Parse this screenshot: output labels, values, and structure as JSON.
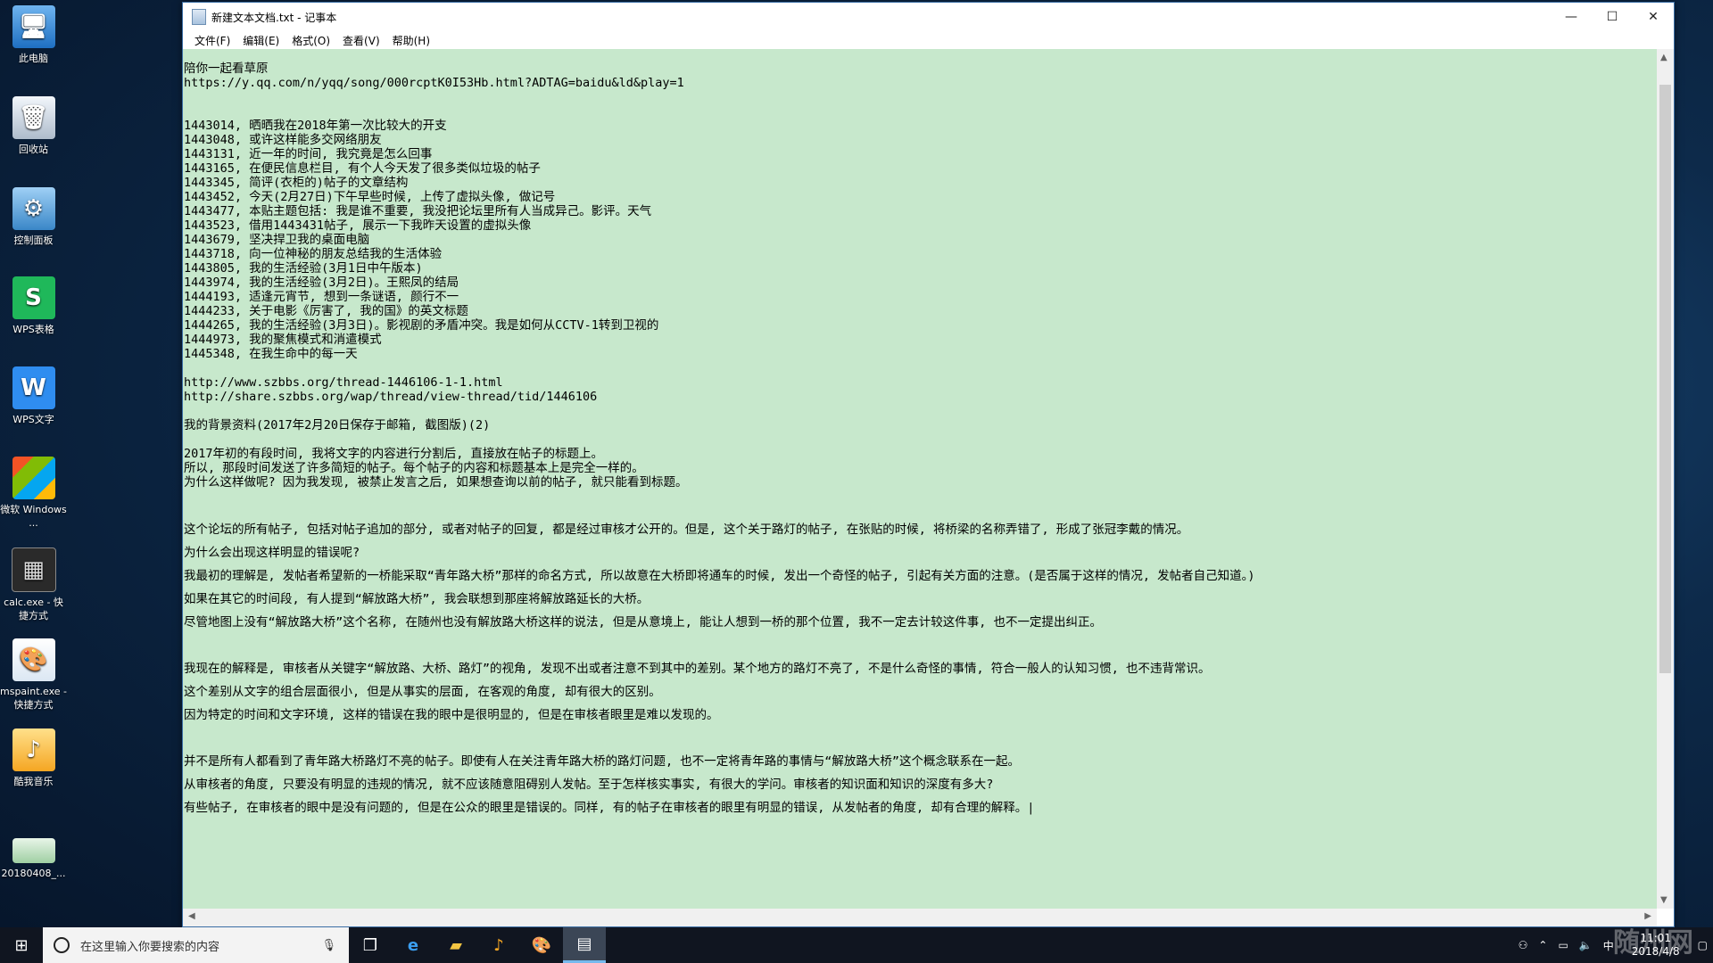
{
  "desktop_icons": [
    {
      "label": "此电脑",
      "icon": "computer-icon"
    },
    {
      "label": "回收站",
      "icon": "recycle-bin-icon"
    },
    {
      "label": "控制面板",
      "icon": "control-panel-icon"
    },
    {
      "label": "WPS表格",
      "icon": "wps-sheet-icon"
    },
    {
      "label": "WPS文字",
      "icon": "wps-writer-icon"
    },
    {
      "label": "微软 Windows ...",
      "icon": "windows-logo-icon"
    },
    {
      "label": "calc.exe - 快捷方式",
      "icon": "calculator-icon"
    },
    {
      "label": "mspaint.exe - 快捷方式",
      "icon": "paint-icon"
    },
    {
      "label": "酷我音乐",
      "icon": "kuwo-music-icon"
    },
    {
      "label": "20180408_...",
      "icon": "image-file-icon"
    }
  ],
  "window": {
    "title": "新建文本文档.txt - 记事本",
    "minimize": "—",
    "maximize": "☐",
    "close": "✕"
  },
  "menu": [
    "文件(F)",
    "编辑(E)",
    "格式(O)",
    "查看(V)",
    "帮助(H)"
  ],
  "content_lines": [
    "陪你一起看草原",
    "https://y.qq.com/n/yqq/song/000rcptK0I53Hb.html?ADTAG=baidu&ld&play=1",
    "",
    "",
    "1443014, 晒晒我在2018年第一次比较大的开支",
    "1443048, 或许这样能多交网络朋友",
    "1443131, 近一年的时间, 我究竟是怎么回事",
    "1443165, 在便民信息栏目, 有个人今天发了很多类似垃圾的帖子",
    "1443345, 简评(衣柜的)帖子的文章结构",
    "1443452, 今天(2月27日)下午早些时候, 上传了虚拟头像, 做记号",
    "1443477, 本贴主题包括: 我是谁不重要, 我没把论坛里所有人当成异己。影评。天气",
    "1443523, 借用1443431帖子, 展示一下我昨天设置的虚拟头像",
    "1443679, 坚决捍卫我的桌面电脑",
    "1443718, 向一位神秘的朋友总结我的生活体验",
    "1443805, 我的生活经验(3月1日中午版本)",
    "1443974, 我的生活经验(3月2日)。王熙凤的结局",
    "1444193, 适逢元宵节, 想到一条谜语, 颜行不一",
    "1444233, 关于电影《厉害了, 我的国》的英文标题",
    "1444265, 我的生活经验(3月3日)。影视剧的矛盾冲突。我是如何从CCTV-1转到卫视的",
    "1444973, 我的聚焦模式和消遣模式",
    "1445348, 在我生命中的每一天",
    "",
    "http://www.szbbs.org/thread-1446106-1-1.html",
    "http://share.szbbs.org/wap/thread/view-thread/tid/1446106",
    "",
    "我的背景资料(2017年2月20日保存于邮箱, 截图版)(2)",
    "",
    "2017年初的有段时间, 我将文字的内容进行分割后, 直接放在帖子的标题上。",
    "所以, 那段时间发送了许多简短的帖子。每个帖子的内容和标题基本上是完全一样的。",
    "为什么这样做呢? 因为我发现, 被禁止发言之后, 如果想查询以前的帖子, 就只能看到标题。",
    "",
    "",
    "这个论坛的所有帖子, 包括对帖子追加的部分, 或者对帖子的回复, 都是经过审核才公开的。但是, 这个关于路灯的帖子, 在张贴的时候, 将桥梁的名称弄错了, 形成了张冠李戴的情况。",
    "为什么会出现这样明显的错误呢?",
    "我最初的理解是, 发帖者希望新的一桥能采取“青年路大桥”那样的命名方式, 所以故意在大桥即将通车的时候, 发出一个奇怪的帖子, 引起有关方面的注意。(是否属于这样的情况, 发帖者自己知道。)",
    "如果在其它的时间段, 有人提到“解放路大桥”, 我会联想到那座将解放路延长的大桥。",
    "尽管地图上没有“解放路大桥”这个名称, 在随州也没有解放路大桥这样的说法, 但是从意境上, 能让人想到一桥的那个位置, 我不一定去计较这件事, 也不一定提出纠正。",
    "",
    "我现在的解释是, 审核者从关键字“解放路、大桥、路灯”的视角, 发现不出或者注意不到其中的差别。某个地方的路灯不亮了, 不是什么奇怪的事情, 符合一般人的认知习惯, 也不违背常识。",
    "这个差别从文字的组合层面很小, 但是从事实的层面, 在客观的角度, 却有很大的区别。",
    "因为特定的时间和文字环境, 这样的错误在我的眼中是很明显的, 但是在审核者眼里是难以发现的。",
    "",
    "并不是所有人都看到了青年路大桥路灯不亮的帖子。即使有人在关注青年路大桥的路灯问题, 也不一定将青年路的事情与“解放路大桥”这个概念联系在一起。",
    "从审核者的角度, 只要没有明显的违规的情况, 就不应该随意阻碍别人发帖。至于怎样核实事实, 有很大的学问。审核者的知识面和知识的深度有多大?",
    "有些帖子, 在审核者的眼中是没有问题的, 但是在公众的眼里是错误的。同样, 有的帖子在审核者的眼里有明显的错误, 从发帖者的角度, 却有合理的解释。|"
  ],
  "taskbar": {
    "search_placeholder": "在这里输入你要搜索的内容",
    "clock_time": "11:01",
    "clock_date": "2018/4/8",
    "ime": "中",
    "watermark": "随州网"
  }
}
